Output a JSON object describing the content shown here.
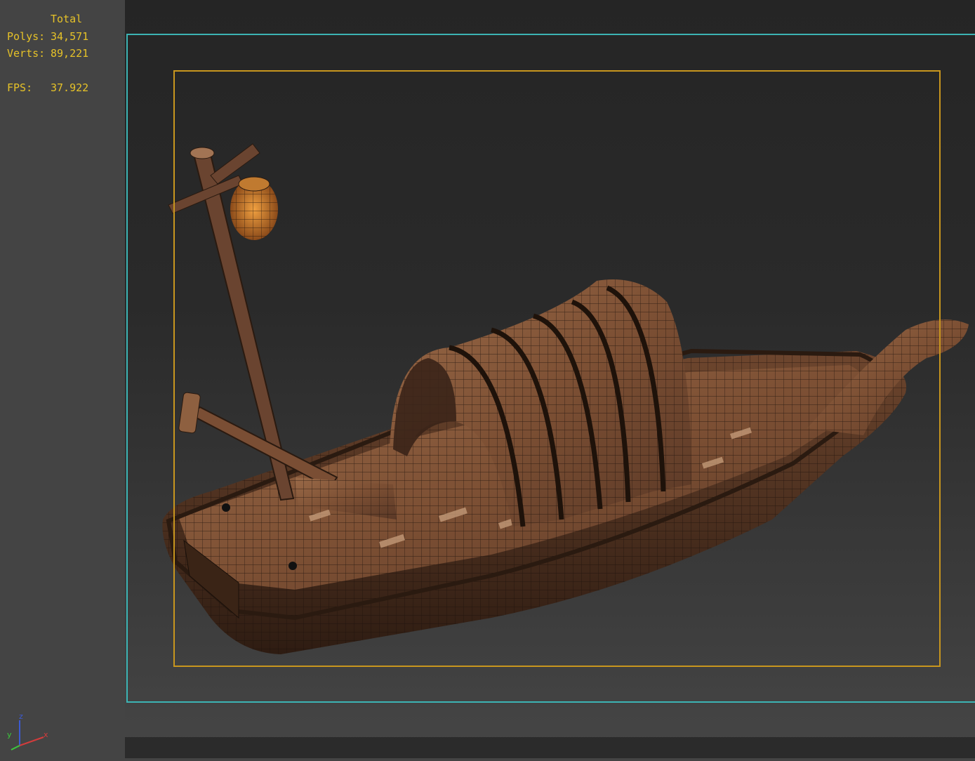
{
  "stats": {
    "header": "Total",
    "polys_label": "Polys:",
    "polys_value": "34,571",
    "verts_label": "Verts:",
    "verts_value": "89,221",
    "fps_label": "FPS:",
    "fps_value": "37.922"
  },
  "axis": {
    "z": "z",
    "y": "y",
    "x": "x"
  },
  "colors": {
    "stats_text": "#e6c228",
    "safe_frame": "#3cb4b4",
    "render_frame": "#c8961e",
    "axis_z": "#3c5ad2",
    "axis_y": "#3cc83c",
    "axis_x": "#d23c3c",
    "wood": "#8a5a3c"
  },
  "viewport": {
    "model": "wooden boat with canopy, lantern pole and oar"
  }
}
